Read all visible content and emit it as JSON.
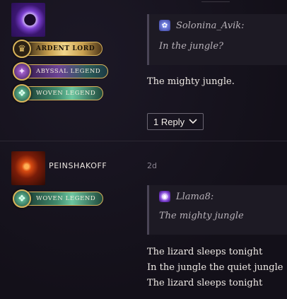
{
  "post1": {
    "badges": [
      {
        "label": "ARDENT LORD",
        "icon": "crown-icon"
      },
      {
        "label": "ABYSSAL LEGEND",
        "icon": "abyssal-emblem-icon"
      },
      {
        "label": "WOVEN LEGEND",
        "icon": "woven-emblem-icon"
      }
    ],
    "quote": {
      "user": "Solonina_Avik:",
      "text": "In the jungle?"
    },
    "message": "The mighty jungle.",
    "reply_button": {
      "label": "1 Reply",
      "icon": "chevron-down-icon"
    }
  },
  "post2": {
    "username": "PEINSHAKOFF",
    "timestamp": "2d",
    "badges": [
      {
        "label": "WOVEN LEGEND",
        "icon": "woven-emblem-icon"
      }
    ],
    "quote": {
      "user": "Llama8:",
      "text": "The mighty jungle"
    },
    "message_lines": [
      "The lizard sleeps tonight",
      "In the jungle the quiet jungle",
      "The lizard sleeps tonight"
    ]
  },
  "colors": {
    "background": "#15121c",
    "quote_bg": "#1d1a24",
    "gold": "#d9b45b",
    "muted_text": "#b7b1b8"
  }
}
